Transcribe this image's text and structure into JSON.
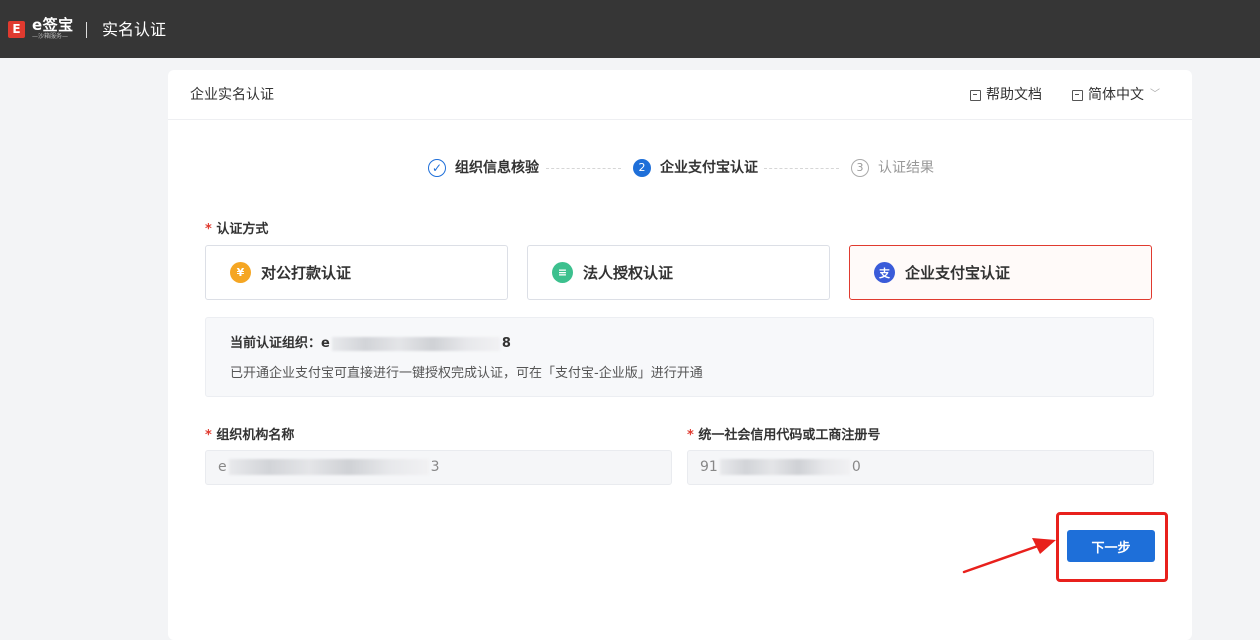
{
  "topbar": {
    "logo_mark": "E",
    "logo_name": "e签宝",
    "logo_tagline": "—沙箱服务—",
    "title": "实名认证"
  },
  "card": {
    "title": "企业实名认证",
    "help_label": "帮助文档",
    "lang_label": "简体中文"
  },
  "steps": [
    {
      "index": "✓",
      "label": "组织信息核验",
      "state": "done"
    },
    {
      "index": "2",
      "label": "企业支付宝认证",
      "state": "active"
    },
    {
      "index": "3",
      "label": "认证结果",
      "state": "pending"
    }
  ],
  "method": {
    "label": "认证方式",
    "options": [
      {
        "label": "对公打款认证",
        "icon": "yen-icon",
        "icon_char": "¥",
        "color": "#f5a623"
      },
      {
        "label": "法人授权认证",
        "icon": "document-icon",
        "icon_char": "≡",
        "color": "#3cc08e"
      },
      {
        "label": "企业支付宝认证",
        "icon": "alipay-icon",
        "icon_char": "支",
        "color": "#3a5bd9",
        "selected": true
      }
    ]
  },
  "info": {
    "org_prefix": "当前认证组织：e",
    "org_suffix": "8",
    "note": "已开通企业支付宝可直接进行一键授权完成认证，可在「支付宝-企业版」进行开通"
  },
  "form": {
    "org_name_label": "组织机构名称",
    "org_name_prefix": "e",
    "org_name_suffix": "3",
    "credit_code_label": "统一社会信用代码或工商注册号",
    "credit_code_prefix": "91",
    "credit_code_suffix": "0"
  },
  "actions": {
    "next_label": "下一步"
  },
  "colors": {
    "primary": "#1e6fd9",
    "danger": "#e03a2f",
    "topbar": "#363636"
  }
}
